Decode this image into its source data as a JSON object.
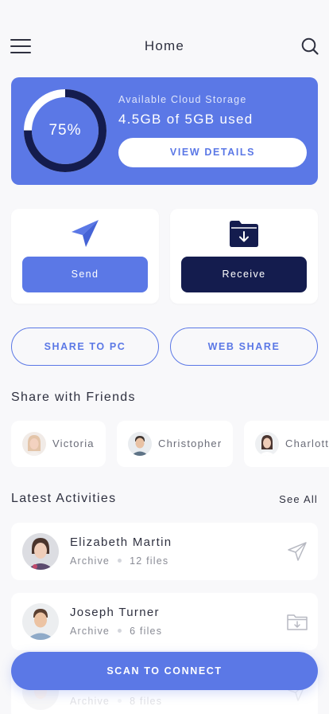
{
  "header": {
    "title": "Home",
    "menu_icon": "hamburger-menu-icon",
    "search_icon": "search-icon"
  },
  "storage": {
    "percent_label": "75%",
    "percent_value": 0.75,
    "label": "Available Cloud Storage",
    "used_text": "4.5GB of 5GB used",
    "details_button": "VIEW DETAILS"
  },
  "actions": {
    "send": {
      "icon": "paper-plane-icon",
      "label": "Send"
    },
    "receive": {
      "icon": "folder-download-icon",
      "label": "Receive"
    }
  },
  "share": {
    "pc_button": "SHARE TO PC",
    "web_button": "WEB SHARE"
  },
  "friends": {
    "title": "Share with Friends",
    "items": [
      {
        "name": "Victoria"
      },
      {
        "name": "Christopher"
      },
      {
        "name": "Charlotte"
      }
    ]
  },
  "activities": {
    "title": "Latest Activities",
    "see_all": "See All",
    "items": [
      {
        "name": "Elizabeth Martin",
        "type": "Archive",
        "files": "12 files",
        "icon": "send-icon"
      },
      {
        "name": "Joseph Turner",
        "type": "Archive",
        "files": "6 files",
        "icon": "folder-receive-icon"
      },
      {
        "name": "",
        "type": "Archive",
        "files": "8 files",
        "icon": "send-icon"
      }
    ]
  },
  "scan_button": "SCAN TO CONNECT",
  "colors": {
    "accent": "#5b78e6",
    "dark": "#141c4e",
    "background": "#f8f8fa"
  }
}
